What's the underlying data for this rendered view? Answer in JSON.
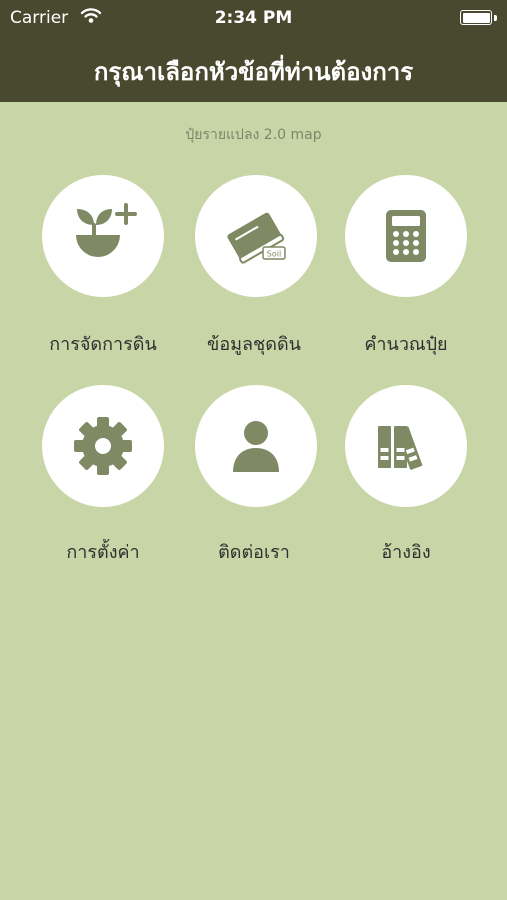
{
  "status_bar": {
    "carrier": "Carrier",
    "time": "2:34 PM",
    "wifi_icon": "wifi-icon",
    "battery_icon": "battery-icon",
    "battery_level": 1.0
  },
  "nav": {
    "title": "กรุณาเลือกหัวข้อที่ท่านต้องการ"
  },
  "subtitle": "ปุ๋ยรายแปลง 2.0 map",
  "colors": {
    "header": "#48492f",
    "background": "#c8d5a6",
    "icon": "#7f8963",
    "circle": "#ffffff"
  },
  "menu": [
    {
      "label": "การจัดการดิน",
      "icon": "plant-plus-icon"
    },
    {
      "label": "ข้อมูลชุดดิน",
      "icon": "soil-book-icon"
    },
    {
      "label": "คำนวณปุ๋ย",
      "icon": "calculator-icon"
    },
    {
      "label": "การตั้งค่า",
      "icon": "gear-icon"
    },
    {
      "label": "ติดต่อเรา",
      "icon": "person-icon"
    },
    {
      "label": "อ้างอิง",
      "icon": "binders-icon"
    }
  ]
}
